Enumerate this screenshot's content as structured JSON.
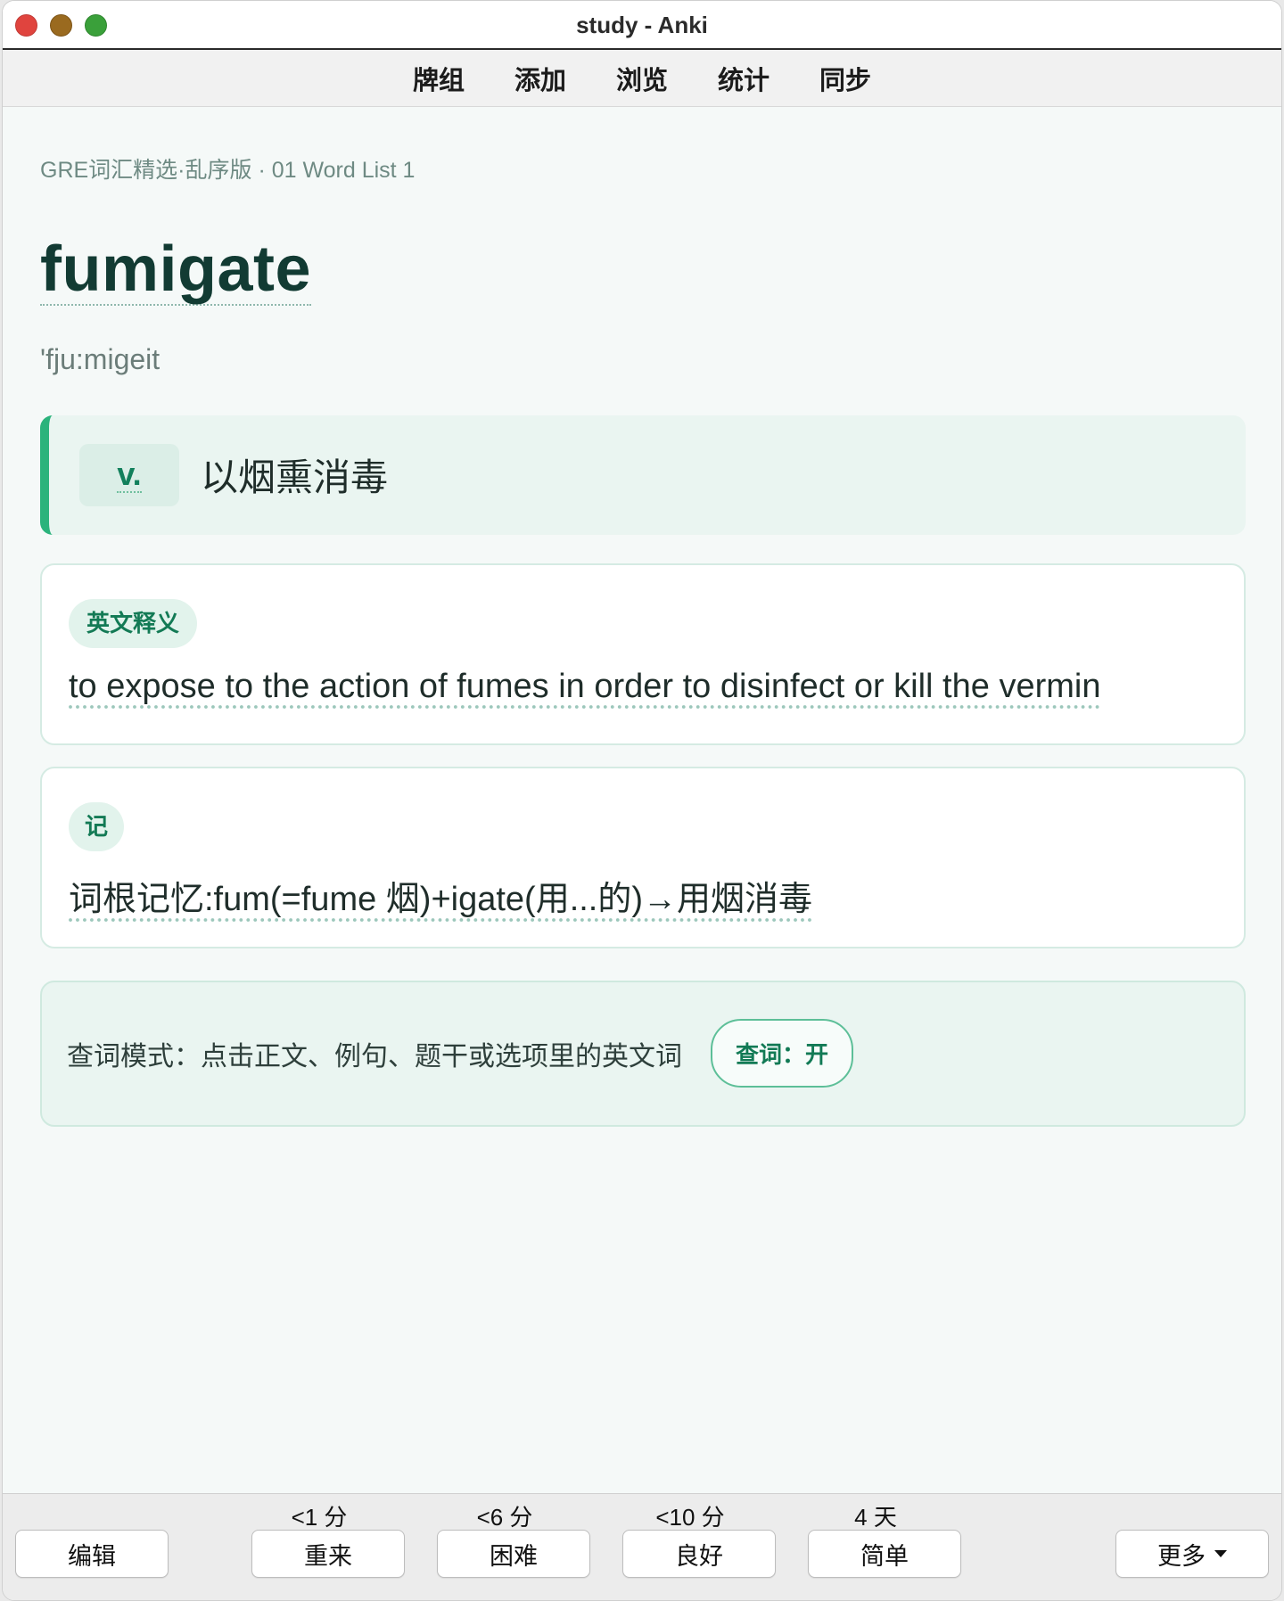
{
  "window": {
    "title": "study - Anki"
  },
  "toolbar": {
    "items": [
      "牌组",
      "添加",
      "浏览",
      "统计",
      "同步"
    ]
  },
  "card": {
    "breadcrumb": "GRE词汇精选·乱序版 · 01 Word List 1",
    "word": "fumigate",
    "phonetic": "'fju:migeit",
    "part_of_speech": "v.",
    "meaning_cn": "以烟熏消毒",
    "english_label": "英文释义",
    "english_definition": "to expose to the action of fumes in order to disinfect or kill the vermin",
    "memo_label": "记",
    "memo_text": "词根记忆:fum(=fume 烟)+igate(用...的)→用烟消毒",
    "lookup_mode_text": "查词模式：点击正文、例句、题干或选项里的英文词",
    "lookup_toggle": "查词：开"
  },
  "bottom": {
    "edit": "编辑",
    "answers": [
      {
        "interval": "<1 分",
        "label": "重来"
      },
      {
        "interval": "<6 分",
        "label": "困难"
      },
      {
        "interval": "<10 分",
        "label": "良好"
      },
      {
        "interval": "4 天",
        "label": "简单"
      }
    ],
    "more": "更多"
  },
  "colors": {
    "accent": "#2bb37c",
    "accent_text": "#137a55",
    "word_color": "#123b33",
    "card_background": "#f5f9f8"
  }
}
